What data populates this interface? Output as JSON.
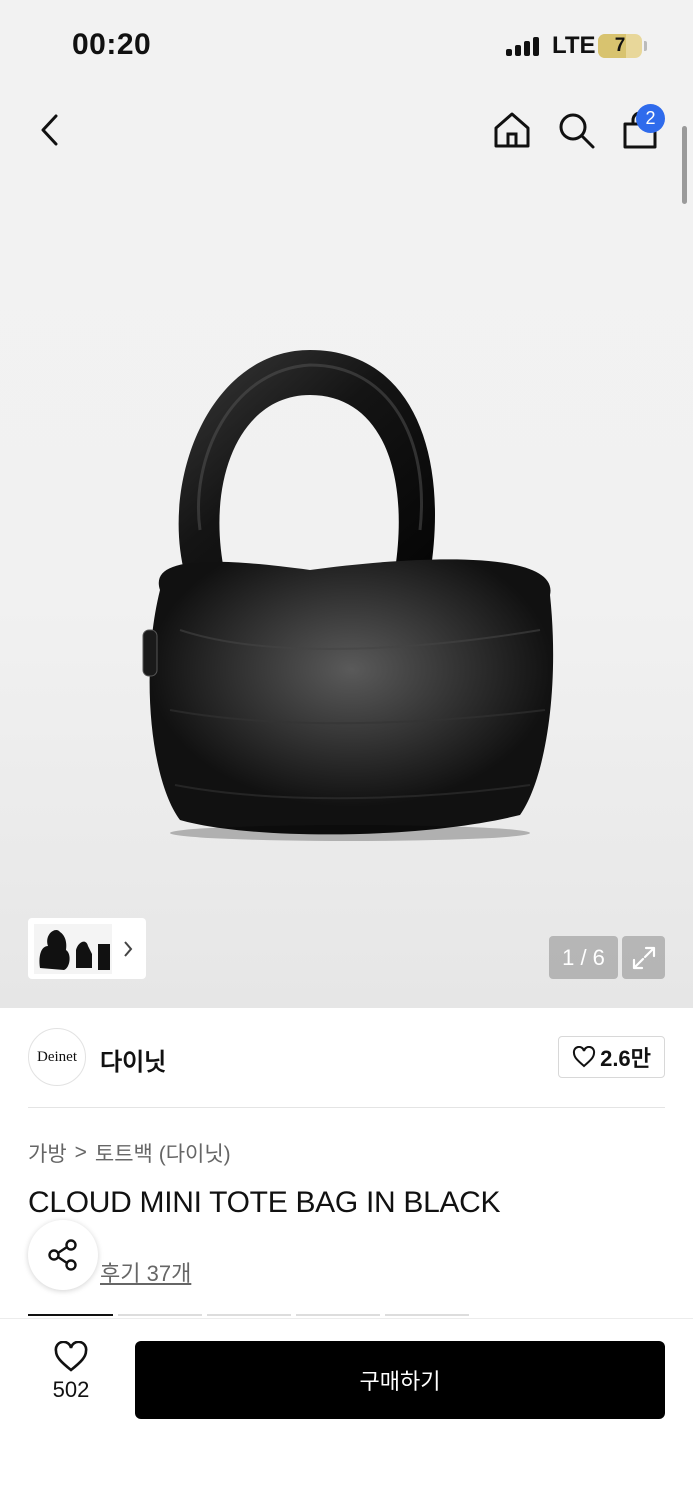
{
  "status_bar": {
    "time": "00:20",
    "network": "LTE",
    "battery": "7"
  },
  "header": {
    "cart_count": "2"
  },
  "gallery": {
    "counter": "1 / 6"
  },
  "brand": {
    "logo_text": "Deinet",
    "name": "다이닛",
    "likes": "2.6만"
  },
  "breadcrumb": {
    "category": "가방",
    "separator": ">",
    "subcategory": "토트백 (다이닛)"
  },
  "product": {
    "title": "CLOUD MINI TOTE BAG IN BLACK",
    "reviews": "후기 37개"
  },
  "bottom_bar": {
    "wish_count": "502",
    "buy_label": "구매하기"
  },
  "colors": {
    "accent_badge": "#2f6bec",
    "buy_button": "#000000"
  }
}
